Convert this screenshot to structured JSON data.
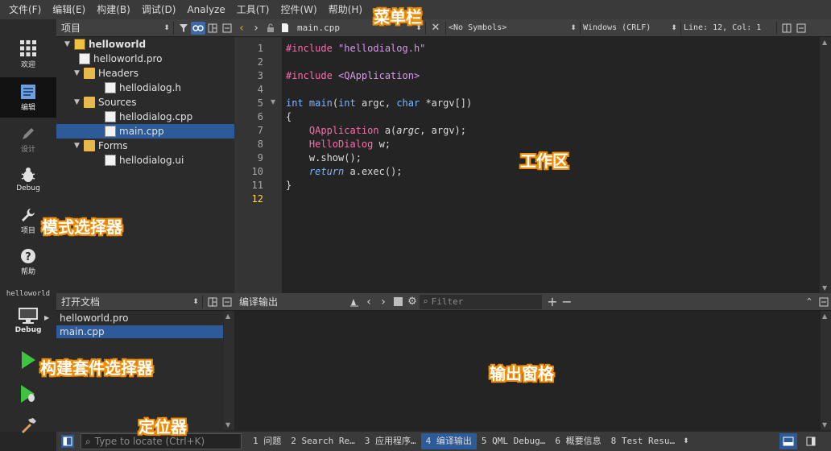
{
  "menubar": {
    "items": [
      "文件(F)",
      "编辑(E)",
      "构建(B)",
      "调试(D)",
      "Analyze",
      "工具(T)",
      "控件(W)",
      "帮助(H)"
    ]
  },
  "modes": [
    {
      "label": "欢迎",
      "icon": "grid-icon"
    },
    {
      "label": "编辑",
      "icon": "edit-document-icon"
    },
    {
      "label": "设计",
      "icon": "pencil-icon"
    },
    {
      "label": "Debug",
      "icon": "bug-icon"
    },
    {
      "label": "项目",
      "icon": "wrench-icon"
    },
    {
      "label": "帮助",
      "icon": "help-icon"
    }
  ],
  "kit": {
    "project": "helloworld",
    "mode": "Debug"
  },
  "project_pane": {
    "title": "项目",
    "tree": [
      {
        "name": "helloworld",
        "type": "project",
        "level": 0,
        "bold": true
      },
      {
        "name": "helloworld.pro",
        "type": "file",
        "level": 1
      },
      {
        "name": "Headers",
        "type": "folder",
        "level": 1
      },
      {
        "name": "hellodialog.h",
        "type": "file",
        "level": 2
      },
      {
        "name": "Sources",
        "type": "folder",
        "level": 1
      },
      {
        "name": "hellodialog.cpp",
        "type": "file",
        "level": 2
      },
      {
        "name": "main.cpp",
        "type": "file",
        "level": 2,
        "selected": true
      },
      {
        "name": "Forms",
        "type": "folder",
        "level": 1
      },
      {
        "name": "hellodialog.ui",
        "type": "file",
        "level": 2
      }
    ]
  },
  "editor": {
    "filename": "main.cpp",
    "symbols": "<No Symbols>",
    "line_ending": "Windows (CRLF)",
    "position": "Line: 12, Col: 1",
    "current_line": 12,
    "line_numbers": [
      "1",
      "2",
      "3",
      "4",
      "5",
      "6",
      "7",
      "8",
      "9",
      "10",
      "11",
      "12"
    ],
    "code": [
      "#include \"hellodialog.h\"",
      "",
      "#include <QApplication>",
      "",
      "int main(int argc, char *argv[])",
      "{",
      "    QApplication a(argc, argv);",
      "    HelloDialog w;",
      "    w.show();",
      "    return a.exec();",
      "}",
      ""
    ]
  },
  "open_docs": {
    "title": "打开文档",
    "items": [
      "helloworld.pro",
      "main.cpp"
    ],
    "selected": "main.cpp"
  },
  "output_pane": {
    "title": "编译输出",
    "filter_placeholder": "Filter"
  },
  "locator": {
    "placeholder": "Type to locate (Ctrl+K)"
  },
  "status_tabs": [
    {
      "num": "1",
      "label": "问题"
    },
    {
      "num": "2",
      "label": "Search Re…"
    },
    {
      "num": "3",
      "label": "应用程序…"
    },
    {
      "num": "4",
      "label": "编译输出",
      "active": true
    },
    {
      "num": "5",
      "label": "QML Debug…"
    },
    {
      "num": "6",
      "label": "概要信息"
    },
    {
      "num": "8",
      "label": "Test Resu…"
    }
  ],
  "annotations": {
    "menubar": "菜单栏",
    "workspace": "工作区",
    "mode_selector": "模式选择器",
    "kit_selector": "构建套件选择器",
    "output_panes": "输出窗格",
    "locator": "定位器"
  },
  "colors": {
    "accent": "#2d5b9a",
    "annotation_stroke": "#f08a00",
    "run_green": "#3ec43e",
    "current_line_number": "#ffd54a"
  }
}
